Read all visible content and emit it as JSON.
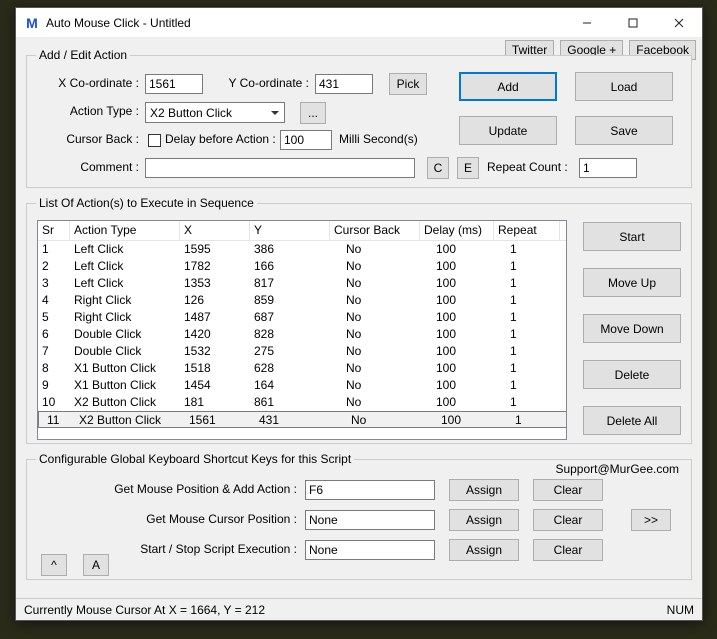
{
  "window": {
    "title": "Auto Mouse Click - Untitled",
    "logo_letter": "M"
  },
  "toplinks": {
    "twitter": "Twitter",
    "google": "Google +",
    "facebook": "Facebook"
  },
  "add_edit": {
    "legend": "Add / Edit Action",
    "x_label": "X Co-ordinate :",
    "x_value": "1561",
    "y_label": "Y Co-ordinate :",
    "y_value": "431",
    "pick": "Pick",
    "action_type_label": "Action Type :",
    "action_type_value": "X2 Button Click",
    "more": "...",
    "cursor_back_label": "Cursor Back :",
    "delay_before_label": "Delay before Action :",
    "delay_before_value": "100",
    "milli": "Milli Second(s)",
    "comment_label": "Comment :",
    "comment_value": "",
    "c": "C",
    "e": "E",
    "repeat_count_label": "Repeat Count :",
    "repeat_count_value": "1"
  },
  "right_buttons": {
    "add": "Add",
    "load": "Load",
    "update": "Update",
    "save": "Save"
  },
  "list": {
    "legend": "List Of Action(s) to Execute in Sequence",
    "cols": {
      "sr": "Sr",
      "type": "Action Type",
      "x": "X",
      "y": "Y",
      "cursor": "Cursor Back",
      "delay": "Delay (ms)",
      "repeat": "Repeat"
    },
    "rows": [
      {
        "sr": "1",
        "type": "Left Click",
        "x": "1595",
        "y": "386",
        "cursor": "No",
        "delay": "100",
        "repeat": "1"
      },
      {
        "sr": "2",
        "type": "Left Click",
        "x": "1782",
        "y": "166",
        "cursor": "No",
        "delay": "100",
        "repeat": "1"
      },
      {
        "sr": "3",
        "type": "Left Click",
        "x": "1353",
        "y": "817",
        "cursor": "No",
        "delay": "100",
        "repeat": "1"
      },
      {
        "sr": "4",
        "type": "Right Click",
        "x": "126",
        "y": "859",
        "cursor": "No",
        "delay": "100",
        "repeat": "1"
      },
      {
        "sr": "5",
        "type": "Right Click",
        "x": "1487",
        "y": "687",
        "cursor": "No",
        "delay": "100",
        "repeat": "1"
      },
      {
        "sr": "6",
        "type": "Double Click",
        "x": "1420",
        "y": "828",
        "cursor": "No",
        "delay": "100",
        "repeat": "1"
      },
      {
        "sr": "7",
        "type": "Double Click",
        "x": "1532",
        "y": "275",
        "cursor": "No",
        "delay": "100",
        "repeat": "1"
      },
      {
        "sr": "8",
        "type": "X1 Button Click",
        "x": "1518",
        "y": "628",
        "cursor": "No",
        "delay": "100",
        "repeat": "1"
      },
      {
        "sr": "9",
        "type": "X1 Button Click",
        "x": "1454",
        "y": "164",
        "cursor": "No",
        "delay": "100",
        "repeat": "1"
      },
      {
        "sr": "10",
        "type": "X2 Button Click",
        "x": "181",
        "y": "861",
        "cursor": "No",
        "delay": "100",
        "repeat": "1"
      },
      {
        "sr": "11",
        "type": "X2 Button Click",
        "x": "1561",
        "y": "431",
        "cursor": "No",
        "delay": "100",
        "repeat": "1"
      }
    ]
  },
  "side_buttons": {
    "start": "Start",
    "moveup": "Move Up",
    "movedown": "Move Down",
    "delete": "Delete",
    "deleteall": "Delete All"
  },
  "shortcuts": {
    "legend": "Configurable Global Keyboard Shortcut Keys for this Script",
    "support": "Support@MurGee.com",
    "row1_label": "Get Mouse Position & Add Action :",
    "row1_value": "F6",
    "row2_label": "Get Mouse Cursor Position :",
    "row2_value": "None",
    "row3_label": "Start / Stop Script Execution :",
    "row3_value": "None",
    "assign": "Assign",
    "clear": "Clear",
    "more": ">>",
    "hat": "^",
    "a": "A"
  },
  "status": {
    "left": "Currently Mouse Cursor At X = 1664, Y = 212",
    "right": "NUM"
  }
}
